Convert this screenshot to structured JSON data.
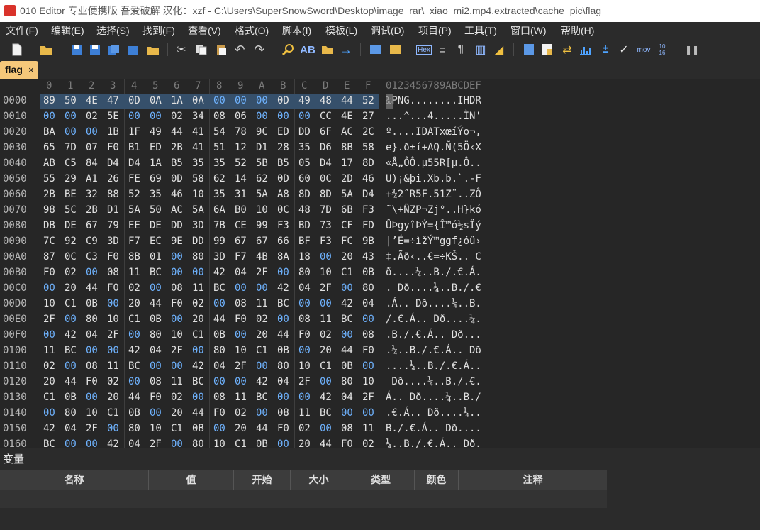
{
  "window": {
    "title": "010 Editor 专业便携版 吾爱破解  汉化：xzf - C:\\Users\\SuperSnowSword\\Desktop\\image_rar\\_xiao_mi2.mp4.extracted\\cache_pic\\flag"
  },
  "menu": [
    "文件(F)",
    "编辑(E)",
    "选择(S)",
    "找到(F)",
    "查看(V)",
    "格式(O)",
    "脚本(I)",
    "模板(L)",
    "调试(D)",
    "项目(P)",
    "工具(T)",
    "窗口(W)",
    "帮助(H)"
  ],
  "toolbar": {
    "hex_label": "Hex",
    "mov_label": "mov",
    "num_label_top": "10",
    "num_label_bottom": "16"
  },
  "tab": {
    "label": "flag",
    "close": "×"
  },
  "hex": {
    "column_headers": [
      "0",
      "1",
      "2",
      "3",
      "4",
      "5",
      "6",
      "7",
      "8",
      "9",
      "A",
      "B",
      "C",
      "D",
      "E",
      "F"
    ],
    "ascii_header": "0123456789ABCDEF",
    "rows": [
      {
        "addr": "0000",
        "bytes": [
          "89",
          "50",
          "4E",
          "47",
          "0D",
          "0A",
          "1A",
          "0A",
          "00",
          "00",
          "00",
          "0D",
          "49",
          "48",
          "44",
          "52"
        ],
        "ascii": "‰PNG........IHDR"
      },
      {
        "addr": "0010",
        "bytes": [
          "00",
          "00",
          "02",
          "5E",
          "00",
          "00",
          "02",
          "34",
          "08",
          "06",
          "00",
          "00",
          "00",
          "CC",
          "4E",
          "27"
        ],
        "ascii": "...^...4.....ÌN'"
      },
      {
        "addr": "0020",
        "bytes": [
          "BA",
          "00",
          "00",
          "1B",
          "1F",
          "49",
          "44",
          "41",
          "54",
          "78",
          "9C",
          "ED",
          "DD",
          "6F",
          "AC",
          "2C"
        ],
        "ascii": "º....IDATxœíÝo¬,"
      },
      {
        "addr": "0030",
        "bytes": [
          "65",
          "7D",
          "07",
          "F0",
          "B1",
          "ED",
          "2B",
          "41",
          "51",
          "12",
          "D1",
          "28",
          "35",
          "D6",
          "8B",
          "58"
        ],
        "ascii": "e}.ð±í+AQ.Ñ(5Ö‹X"
      },
      {
        "addr": "0040",
        "bytes": [
          "AB",
          "C5",
          "84",
          "D4",
          "D4",
          "1A",
          "B5",
          "35",
          "35",
          "52",
          "5B",
          "B5",
          "05",
          "D4",
          "17",
          "8D"
        ],
        "ascii": "«Å„ÔÔ.µ55R[µ.Ô.."
      },
      {
        "addr": "0050",
        "bytes": [
          "55",
          "29",
          "A1",
          "26",
          "FE",
          "69",
          "0D",
          "58",
          "62",
          "14",
          "62",
          "0D",
          "60",
          "0C",
          "2D",
          "46"
        ],
        "ascii": "U)¡&þi.Xb.b.`.-F"
      },
      {
        "addr": "0060",
        "bytes": [
          "2B",
          "BE",
          "32",
          "88",
          "52",
          "35",
          "46",
          "10",
          "35",
          "31",
          "5A",
          "A8",
          "8D",
          "8D",
          "5A",
          "D4"
        ],
        "ascii": "+¾2ˆR5F.51Z¨..ZÔ"
      },
      {
        "addr": "0070",
        "bytes": [
          "98",
          "5C",
          "2B",
          "D1",
          "5A",
          "50",
          "AC",
          "5A",
          "6A",
          "B0",
          "10",
          "0C",
          "48",
          "7D",
          "6B",
          "F3"
        ],
        "ascii": "˜\\+ÑZP¬Zj°..H}kó"
      },
      {
        "addr": "0080",
        "bytes": [
          "DB",
          "DE",
          "67",
          "79",
          "EE",
          "DE",
          "DD",
          "3D",
          "7B",
          "CE",
          "99",
          "F3",
          "BD",
          "73",
          "CF",
          "FD"
        ],
        "ascii": "ÛÞgyîÞÝ={Î™ó½sÏý"
      },
      {
        "addr": "0090",
        "bytes": [
          "7C",
          "92",
          "C9",
          "3D",
          "F7",
          "EC",
          "9E",
          "DD",
          "99",
          "67",
          "67",
          "66",
          "BF",
          "F3",
          "FC",
          "9B"
        ],
        "ascii": "|’É=÷ìžÝ™ggf¿óü›"
      },
      {
        "addr": "00A0",
        "bytes": [
          "87",
          "0C",
          "C3",
          "F0",
          "8B",
          "01",
          "00",
          "80",
          "3D",
          "F7",
          "4B",
          "8A",
          "18",
          "00",
          "20",
          "43"
        ],
        "ascii": "‡.Ãð‹..€=÷KŠ.. C"
      },
      {
        "addr": "00B0",
        "bytes": [
          "F0",
          "02",
          "00",
          "08",
          "11",
          "BC",
          "00",
          "00",
          "42",
          "04",
          "2F",
          "00",
          "80",
          "10",
          "C1",
          "0B"
        ],
        "ascii": "ð....¼..B./.€.Á."
      },
      {
        "addr": "00C0",
        "bytes": [
          "00",
          "20",
          "44",
          "F0",
          "02",
          "00",
          "08",
          "11",
          "BC",
          "00",
          "00",
          "42",
          "04",
          "2F",
          "00",
          "80"
        ],
        "ascii": ". Dð....¼..B./.€"
      },
      {
        "addr": "00D0",
        "bytes": [
          "10",
          "C1",
          "0B",
          "00",
          "20",
          "44",
          "F0",
          "02",
          "00",
          "08",
          "11",
          "BC",
          "00",
          "00",
          "42",
          "04"
        ],
        "ascii": ".Á.. Dð....¼..B."
      },
      {
        "addr": "00E0",
        "bytes": [
          "2F",
          "00",
          "80",
          "10",
          "C1",
          "0B",
          "00",
          "20",
          "44",
          "F0",
          "02",
          "00",
          "08",
          "11",
          "BC",
          "00"
        ],
        "ascii": "/.€.Á.. Dð....¼."
      },
      {
        "addr": "00F0",
        "bytes": [
          "00",
          "42",
          "04",
          "2F",
          "00",
          "80",
          "10",
          "C1",
          "0B",
          "00",
          "20",
          "44",
          "F0",
          "02",
          "00",
          "08"
        ],
        "ascii": ".B./.€.Á.. Dð..."
      },
      {
        "addr": "0100",
        "bytes": [
          "11",
          "BC",
          "00",
          "00",
          "42",
          "04",
          "2F",
          "00",
          "80",
          "10",
          "C1",
          "0B",
          "00",
          "20",
          "44",
          "F0"
        ],
        "ascii": ".¼..B./.€.Á.. Dð"
      },
      {
        "addr": "0110",
        "bytes": [
          "02",
          "00",
          "08",
          "11",
          "BC",
          "00",
          "00",
          "42",
          "04",
          "2F",
          "00",
          "80",
          "10",
          "C1",
          "0B",
          "00"
        ],
        "ascii": "....¼..B./.€.Á.."
      },
      {
        "addr": "0120",
        "bytes": [
          "20",
          "44",
          "F0",
          "02",
          "00",
          "08",
          "11",
          "BC",
          "00",
          "00",
          "42",
          "04",
          "2F",
          "00",
          "80",
          "10"
        ],
        "ascii": " Dð....¼..B./.€."
      },
      {
        "addr": "0130",
        "bytes": [
          "C1",
          "0B",
          "00",
          "20",
          "44",
          "F0",
          "02",
          "00",
          "08",
          "11",
          "BC",
          "00",
          "00",
          "42",
          "04",
          "2F"
        ],
        "ascii": "Á.. Dð....¼..B./"
      },
      {
        "addr": "0140",
        "bytes": [
          "00",
          "80",
          "10",
          "C1",
          "0B",
          "00",
          "20",
          "44",
          "F0",
          "02",
          "00",
          "08",
          "11",
          "BC",
          "00",
          "00"
        ],
        "ascii": ".€.Á.. Dð....¼.."
      },
      {
        "addr": "0150",
        "bytes": [
          "42",
          "04",
          "2F",
          "00",
          "80",
          "10",
          "C1",
          "0B",
          "00",
          "20",
          "44",
          "F0",
          "02",
          "00",
          "08",
          "11"
        ],
        "ascii": "B./.€.Á.. Dð...."
      },
      {
        "addr": "0160",
        "bytes": [
          "BC",
          "00",
          "00",
          "42",
          "04",
          "2F",
          "00",
          "80",
          "10",
          "C1",
          "0B",
          "00",
          "20",
          "44",
          "F0",
          "02"
        ],
        "ascii": "¼..B./.€.Á.. Dð."
      }
    ]
  },
  "variables_panel": {
    "title": "变量",
    "columns": [
      "名称",
      "值",
      "开始",
      "大小",
      "类型",
      "颜色",
      "注释"
    ]
  },
  "colors": {
    "zero_byte": "#6fb3ff",
    "tab_bg": "#f6c87a",
    "selection": "#36506b"
  }
}
